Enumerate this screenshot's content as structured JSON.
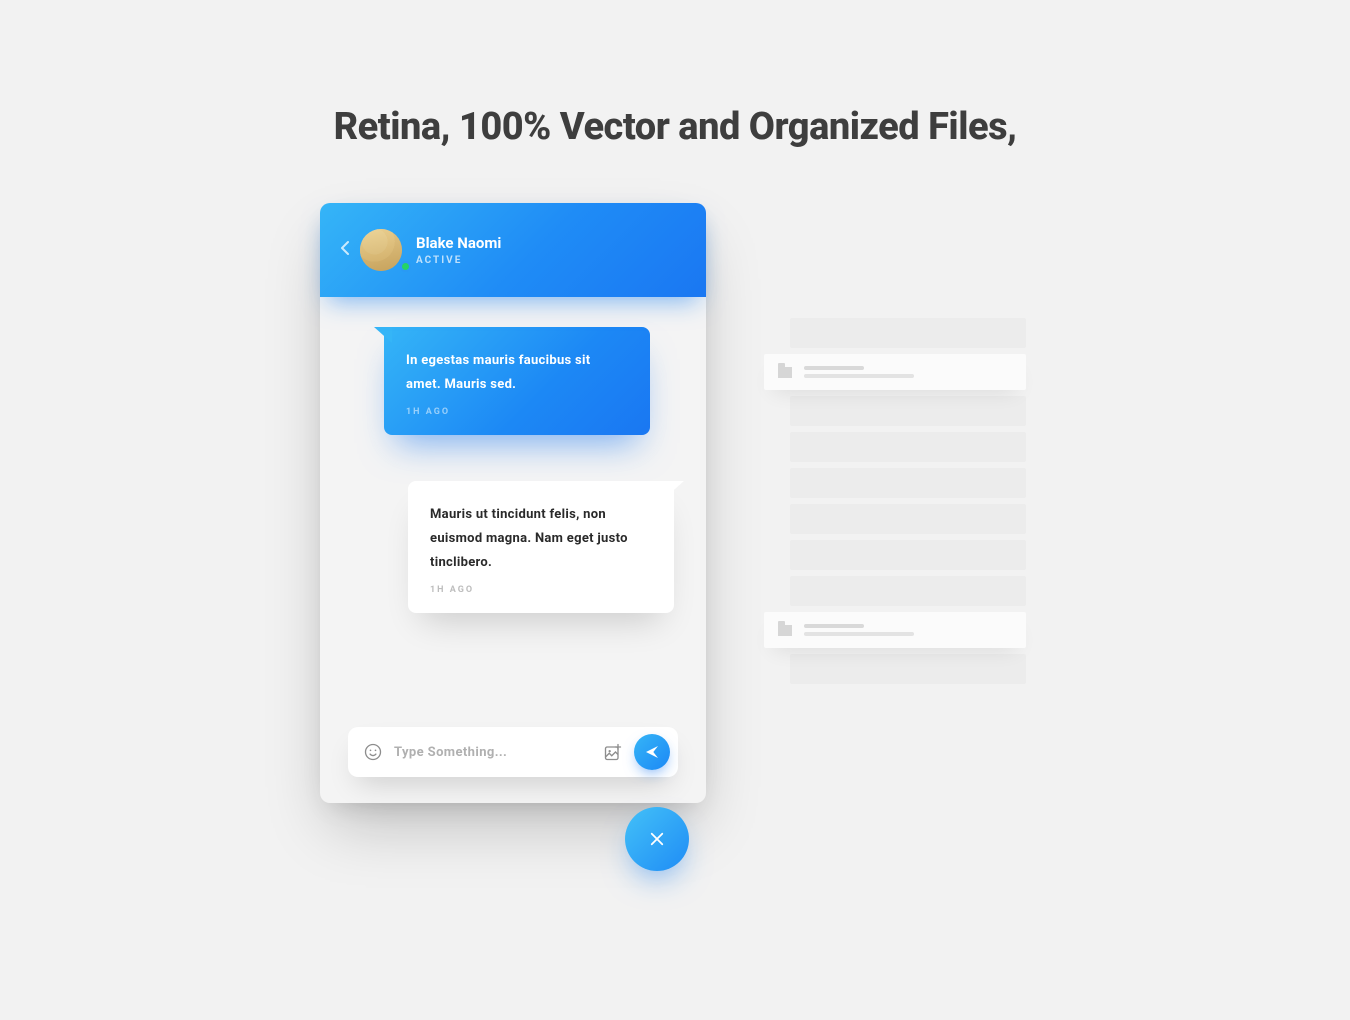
{
  "headline": "Retina, 100% Vector and Organized Files,",
  "chat": {
    "user": {
      "name": "Blake Naomi",
      "status": "ACTIVE"
    },
    "messages": [
      {
        "text": "In egestas mauris faucibus sit amet. Mauris sed.",
        "time": "1H AGO",
        "direction": "in"
      },
      {
        "text": "Mauris ut tincidunt felis, non euismod magna. Nam eget justo tinclibero.",
        "time": "1H AGO",
        "direction": "out"
      }
    ],
    "compose": {
      "placeholder": "Type Something..."
    }
  }
}
